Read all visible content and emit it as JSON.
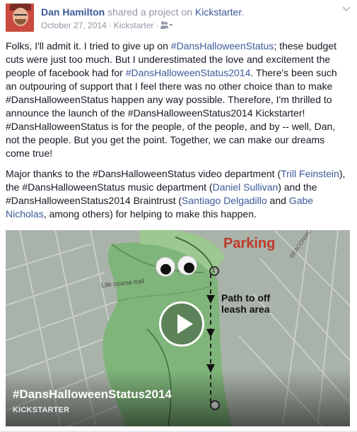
{
  "post": {
    "author": "Dan Hamilton",
    "verb": "shared a project on",
    "target": "Kickstarter",
    "target_suffix": ".",
    "date": "October 27, 2014",
    "separator": "·",
    "source": "Kickstarter",
    "audience_icon": "friends-icon",
    "options_icon": "chevron-down-icon"
  },
  "message": {
    "p1": [
      {
        "t": "Folks, I'll admit it. I tried to give up on ",
        "k": "text"
      },
      {
        "t": "#DansHalloweenStatus",
        "k": "hashtag"
      },
      {
        "t": "; these budget cuts were just too much. But I underestimated the love and excitement the people of facebook had for ",
        "k": "text"
      },
      {
        "t": "#DansHalloweenStatus2014",
        "k": "hashtag"
      },
      {
        "t": ". There's been such an outpouring of support that I feel there was no other choice than to make #DansHalloweenStatus happen any way possible. Therefore, I'm thrilled to announce the launch of the #DansHalloweenStatus2014 Kickstarter! #DansHalloweenStatus is for the people, of the people, and by -- well, Dan, not the people. But you get the point. Together, we can make our dreams come true!",
        "k": "text"
      }
    ],
    "p2": [
      {
        "t": "Major thanks to the #DansHalloweenStatus video department (",
        "k": "text"
      },
      {
        "t": "Trill Feinstein",
        "k": "mention"
      },
      {
        "t": "), the #DansHalloweenStatus music department (",
        "k": "text"
      },
      {
        "t": "Daniel Sullivan",
        "k": "mention"
      },
      {
        "t": ") and the #DansHalloweenStatus2014 Braintrust (",
        "k": "text"
      },
      {
        "t": "Santiago Delgadillo",
        "k": "mention"
      },
      {
        "t": " and ",
        "k": "text"
      },
      {
        "t": "Gabe Nicholas",
        "k": "mention"
      },
      {
        "t": ", among others) for helping to make this happen.",
        "k": "text"
      }
    ]
  },
  "video": {
    "title": "#DansHalloweenStatus2014",
    "source": "KICKSTARTER",
    "play_icon": "play-icon",
    "map_labels": {
      "parking": "Parking",
      "path": "Path to off leash area",
      "course": "Life course trail",
      "road": "BEACONWOOD RD"
    }
  },
  "colors": {
    "link": "#3b5998",
    "meta": "#9197a3",
    "text": "#141823",
    "parking": "#c0392b"
  }
}
